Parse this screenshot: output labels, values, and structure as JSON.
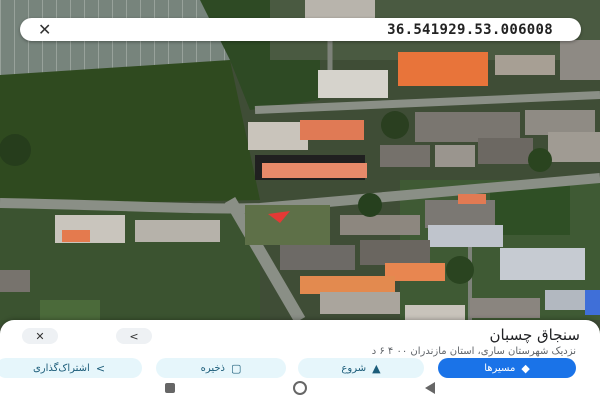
{
  "search": {
    "coordinates": "36.541929.53.006008",
    "close_icon": "close-icon"
  },
  "place": {
    "title": "سنجاق چسبان",
    "subtitle": "نزدیک شهرستان ساری، استان مازندران ۰۰ ۴ ۶ د"
  },
  "actions": {
    "routes": "مسیرها",
    "start": "شروع",
    "save": "ذخیره",
    "share": "اشتراک‌گذاری"
  },
  "icons": {
    "close": "close-icon",
    "share": "share-icon",
    "routes": "directions-icon",
    "start": "navigation-arrow-icon",
    "save": "bookmark-icon",
    "pin": "location-pin-icon"
  },
  "colors": {
    "pin": "#e53935",
    "primary_chip": "#1a73e8",
    "outline_chip": "#e6f6fb"
  }
}
